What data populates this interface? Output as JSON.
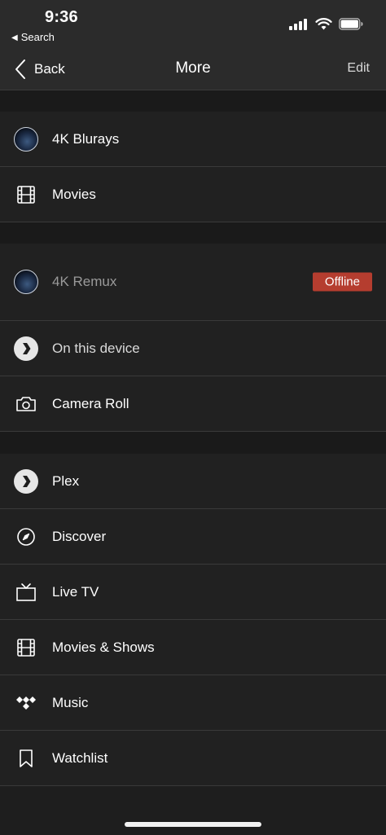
{
  "status_bar": {
    "time": "9:36",
    "back_app": "Search",
    "icons": [
      "cellular-signal",
      "wifi",
      "battery"
    ]
  },
  "navbar": {
    "back_label": "Back",
    "title": "More",
    "edit_label": "Edit"
  },
  "sections": [
    {
      "items": [
        {
          "label": "4K Blurays",
          "icon": "server-avatar"
        },
        {
          "label": "Movies",
          "icon": "film-strip"
        }
      ]
    },
    {
      "items": [
        {
          "label": "4K Remux",
          "icon": "server-avatar",
          "status": "Offline",
          "status_color": "#b53d2f"
        }
      ]
    },
    {
      "items": [
        {
          "label": "On this device",
          "icon": "plex-chevron"
        },
        {
          "label": "Camera Roll",
          "icon": "camera"
        }
      ]
    },
    {
      "items": [
        {
          "label": "Plex",
          "icon": "plex-chevron"
        },
        {
          "label": "Discover",
          "icon": "compass"
        },
        {
          "label": "Live TV",
          "icon": "tv"
        },
        {
          "label": "Movies & Shows",
          "icon": "film-strip"
        },
        {
          "label": "Music",
          "icon": "tidal"
        },
        {
          "label": "Watchlist",
          "icon": "bookmark"
        }
      ]
    }
  ],
  "colors": {
    "background": "#1e1e1e",
    "row_background": "#212121",
    "offline_badge": "#b53d2f"
  }
}
